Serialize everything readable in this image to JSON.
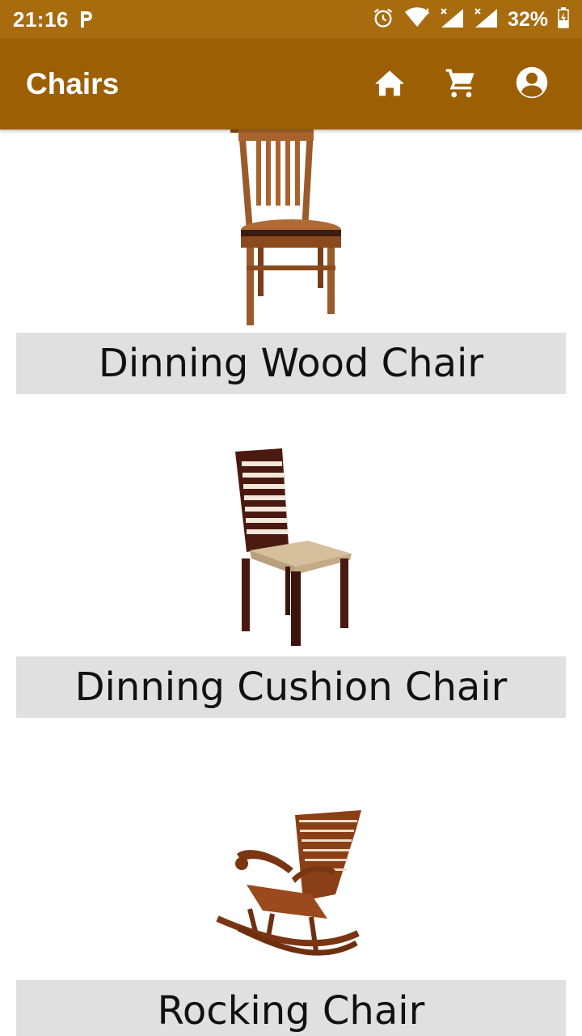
{
  "status_bar": {
    "time": "21:16",
    "battery": "32%"
  },
  "app_bar": {
    "title": "Chairs",
    "actions": [
      {
        "icon": "home-icon"
      },
      {
        "icon": "cart-icon"
      },
      {
        "icon": "account-icon"
      }
    ]
  },
  "products": [
    {
      "name": "Dinning Wood Chair"
    },
    {
      "name": "Dinning Cushion Chair"
    },
    {
      "name": "Rocking Chair"
    }
  ],
  "colors": {
    "status_bar": "#A86B0E",
    "app_bar": "#9C5F04",
    "label_bg": "#E0E0E0"
  }
}
